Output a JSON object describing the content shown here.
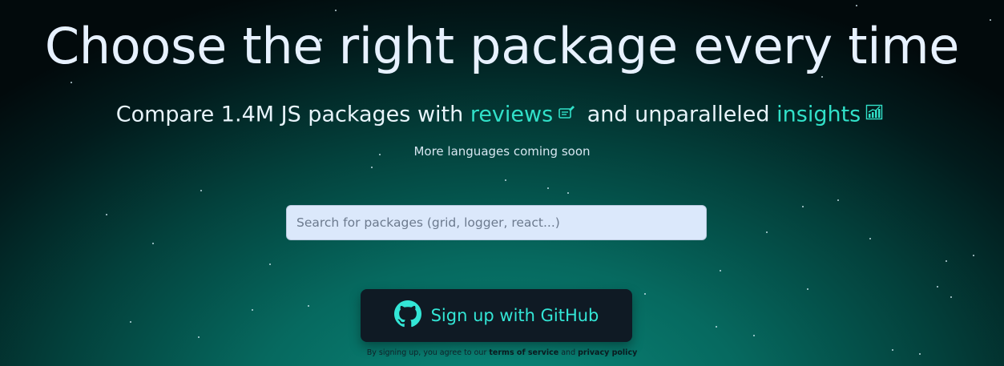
{
  "hero": {
    "title": "Choose the right package every time",
    "subtitle_prefix": "Compare 1.4M JS packages with ",
    "subtitle_reviews": "reviews",
    "subtitle_middle": " and unparalleled ",
    "subtitle_insights": "insights",
    "reviews_icon": "thumbs-up-pencil-icon",
    "insights_icon": "chart-increasing-icon",
    "accent_color": "#31e0c8",
    "languages_note": "More languages coming soon"
  },
  "search": {
    "placeholder": "Search for packages (grid, logger, react...)",
    "value": ""
  },
  "signup": {
    "button_label": "Sign up with GitHub",
    "icon": "github-icon",
    "legal_prefix": "By signing up, you agree to our ",
    "terms_link": "terms of service",
    "legal_middle": " and ",
    "privacy_link": "privacy policy"
  }
}
